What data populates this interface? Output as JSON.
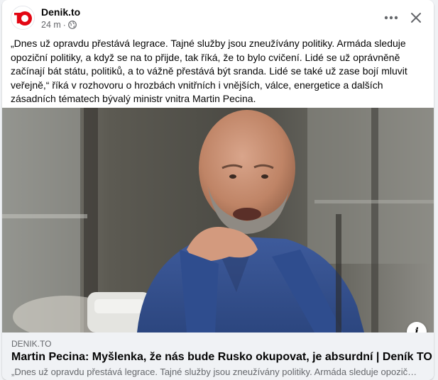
{
  "post": {
    "page_name": "Denik.to",
    "avatar_text": "TO",
    "time": "24 m",
    "separator": "·",
    "body": "„Dnes už opravdu přestává legrace. Tajné služby jsou zneužívány politiky. Armáda sleduje opoziční politiky, a když se na to přijde, tak říká, že to bylo cvičení. Lidé se už oprávněně začínají bát státu, politiků, a to vážně přestává být sranda. Lidé se také už zase bojí mluvit veřejně,“ říká v rozhovoru o hrozbách vnitřních i vnějších, válce, energetice a dalších zásadních tématech bývalý ministr vnitra Martin Pecina."
  },
  "header": {
    "more_icon": "more-horizontal-icon",
    "close_icon": "close-icon",
    "privacy_icon": "globe-icon"
  },
  "link_preview": {
    "domain": "DENIK.TO",
    "title": "Martin Pecina: Myšlenka, že nás bude Rusko okupovat, je absurdní | Deník TO",
    "description": "„Dnes už opravdu přestává legrace. Tajné služby jsou zneužívány politiky. Armáda sleduje opoziční politiky, a když se na to přijde",
    "info_label": "i"
  },
  "colors": {
    "brand_red": "#e30613",
    "text_primary": "#050505",
    "text_secondary": "#65676b",
    "link_bg": "#f0f2f5"
  }
}
